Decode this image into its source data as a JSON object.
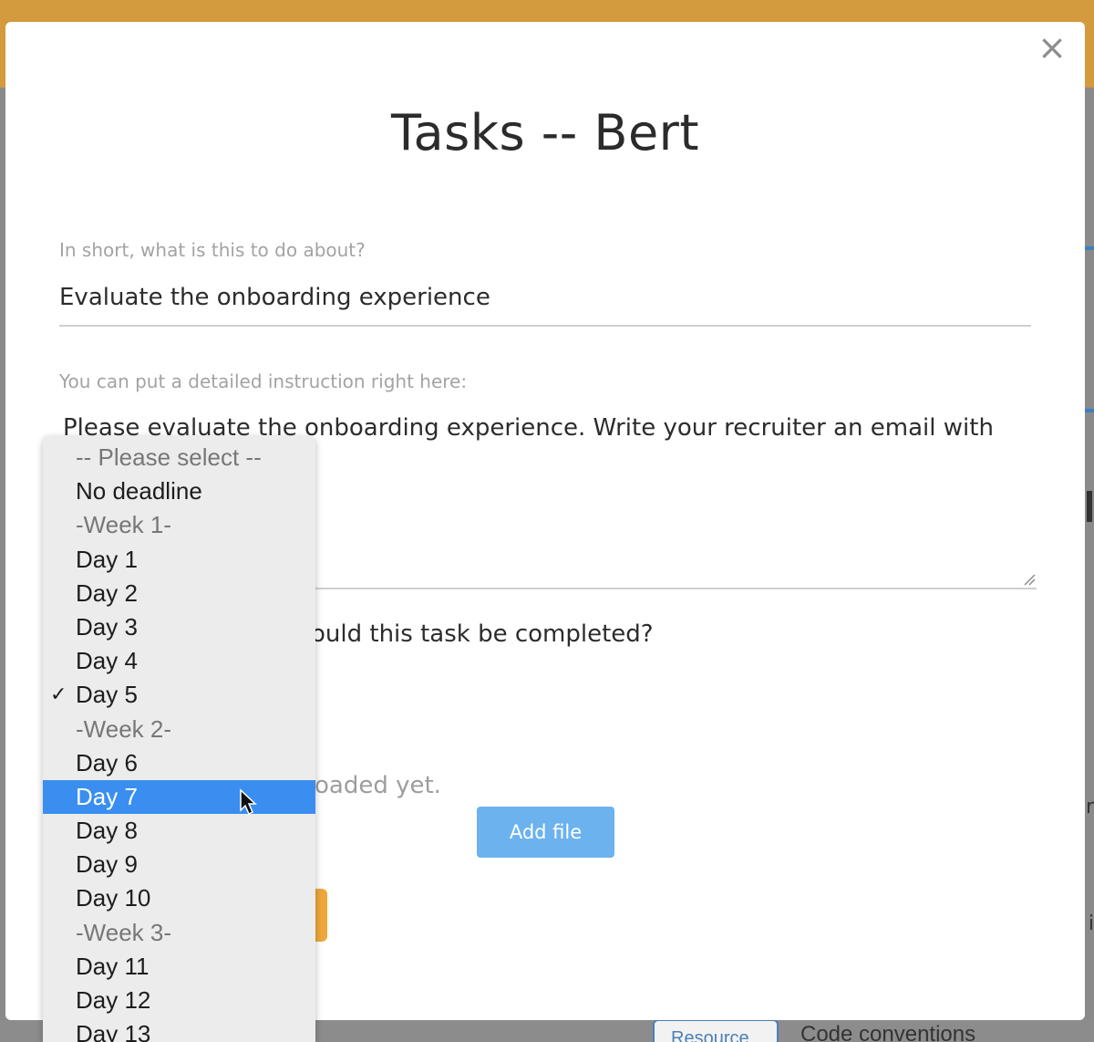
{
  "modal": {
    "title": "Tasks -- Bert",
    "close_label": "×",
    "summary_label": "In short, what is this to do about?",
    "summary_value": "Evaluate the onboarding experience",
    "instructions_label": "You can put a detailed instruction right here:",
    "instructions_value": "Please evaluate the onboarding experience. Write your recruiter an email with",
    "deadline_question_partial": "ould this task be completed?",
    "files_empty_partial": "oaded yet.",
    "add_file_label": "Add file"
  },
  "dropdown": {
    "items": [
      {
        "label": "-- Please select --",
        "type": "group"
      },
      {
        "label": "No deadline",
        "type": "option"
      },
      {
        "label": "-Week 1-",
        "type": "group"
      },
      {
        "label": "Day 1",
        "type": "option"
      },
      {
        "label": "Day 2",
        "type": "option"
      },
      {
        "label": "Day 3",
        "type": "option"
      },
      {
        "label": "Day 4",
        "type": "option"
      },
      {
        "label": "Day 5",
        "type": "option",
        "checked": true
      },
      {
        "label": "-Week 2-",
        "type": "group"
      },
      {
        "label": "Day 6",
        "type": "option"
      },
      {
        "label": "Day 7",
        "type": "option",
        "hovered": true
      },
      {
        "label": "Day 8",
        "type": "option"
      },
      {
        "label": "Day 9",
        "type": "option"
      },
      {
        "label": "Day 10",
        "type": "option"
      },
      {
        "label": "-Week 3-",
        "type": "group"
      },
      {
        "label": "Day 11",
        "type": "option"
      },
      {
        "label": "Day 12",
        "type": "option"
      },
      {
        "label": "Day 13",
        "type": "option"
      }
    ],
    "checkmark": "✓",
    "highlight_color": "#3a8ef0"
  },
  "background": {
    "resource_button_partial": "Resource",
    "code_conventions_partial": "Code conventions",
    "right_edge_letter_1": "r",
    "right_edge_letter_2": "i",
    "topbar_color": "#d39a3e"
  }
}
